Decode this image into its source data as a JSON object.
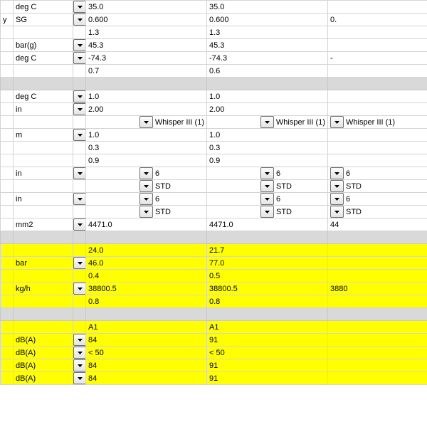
{
  "labels": {
    "y": "y"
  },
  "units": {
    "degC": "deg C",
    "sg": "SG",
    "barg": "bar(g)",
    "in": "in",
    "m": "m",
    "mm2": "mm2",
    "bar": "bar",
    "kgh": "kg/h",
    "dba": "dB(A)"
  },
  "tags": {
    "whisper": "Whisper III (1)",
    "six": "6",
    "std": "STD",
    "a1": "A1",
    "lt50": "< 50"
  },
  "rows": {
    "r0": {
      "u": "degC",
      "v1": "35.0",
      "v2": "35.0",
      "v3": ""
    },
    "r1": {
      "u": "sg",
      "lab": "y",
      "v1": "0.600",
      "v2": "0.600",
      "v3": "0."
    },
    "r2": {
      "u": "",
      "v1": "1.3",
      "v2": "1.3",
      "v3": ""
    },
    "r3": {
      "u": "barg",
      "v1": "45.3",
      "v2": "45.3",
      "v3": ""
    },
    "r4": {
      "u": "degC",
      "v1": "-74.3",
      "v2": "-74.3",
      "v3": "-"
    },
    "r5": {
      "u": "",
      "v1": "0.7",
      "v2": "0.6",
      "v3": ""
    },
    "r6": {
      "u": "degC",
      "v1": "1.0",
      "v2": "1.0",
      "v3": ""
    },
    "r7": {
      "u": "in",
      "v1": "2.00",
      "v2": "2.00",
      "v3": ""
    },
    "r8": {
      "dd": "whisper"
    },
    "r9": {
      "u": "m",
      "v1": "1.0",
      "v2": "1.0",
      "v3": ""
    },
    "r10": {
      "u": "",
      "v1": "0.3",
      "v2": "0.3",
      "v3": ""
    },
    "r11": {
      "u": "",
      "v1": "0.9",
      "v2": "0.9",
      "v3": ""
    },
    "r12": {
      "u": "in",
      "dd": "six"
    },
    "r13": {
      "dd": "std"
    },
    "r14": {
      "u": "in",
      "dd": "six"
    },
    "r15": {
      "dd": "std"
    },
    "r16": {
      "u": "mm2",
      "v1": "4471.0",
      "v2": "4471.0",
      "v3": "44"
    },
    "r17": {
      "v1": "24.0",
      "v2": "21.7",
      "v3": ""
    },
    "r18": {
      "u": "bar",
      "v1": "46.0",
      "v2": "77.0",
      "v3": ""
    },
    "r19": {
      "v1": "0.4",
      "v2": "0.5",
      "v3": ""
    },
    "r20": {
      "u": "kgh",
      "v1": "38800.5",
      "v2": "38800.5",
      "v3": "3880"
    },
    "r21": {
      "v1": "0.8",
      "v2": "0.8",
      "v3": ""
    },
    "r22": {
      "v1": "A1",
      "v2": "A1",
      "v3": ""
    },
    "r23": {
      "u": "dba",
      "v1": "84",
      "v2": "91",
      "v3": ""
    },
    "r24": {
      "u": "dba",
      "v1": "< 50",
      "v2": "< 50",
      "v3": ""
    },
    "r25": {
      "u": "dba",
      "v1": "84",
      "v2": "91",
      "v3": ""
    },
    "r26": {
      "u": "dba",
      "v1": "84",
      "v2": "91",
      "v3": ""
    }
  }
}
